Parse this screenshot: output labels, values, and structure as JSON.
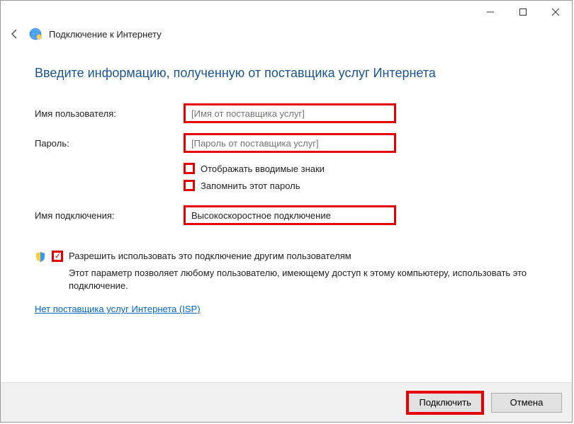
{
  "window": {
    "title": "Подключение к Интернету"
  },
  "heading": "Введите информацию, полученную от поставщика услуг Интернета",
  "form": {
    "username_label": "Имя пользователя:",
    "username_placeholder": "[Имя от поставщика услуг]",
    "password_label": "Пароль:",
    "password_placeholder": "[Пароль от поставщика услуг]",
    "show_chars_label": "Отображать вводимые знаки",
    "remember_label": "Запомнить этот пароль",
    "conn_name_label": "Имя подключения:",
    "conn_name_value": "Высокоскоростное подключение"
  },
  "permission": {
    "checkbox_label": "Разрешить использовать это подключение другим пользователям",
    "description": "Этот параметр позволяет любому пользователю, имеющему доступ к этому компьютеру, использовать это подключение."
  },
  "link_text": "Нет поставщика услуг Интернета (ISP)",
  "buttons": {
    "connect": "Подключить",
    "cancel": "Отмена"
  }
}
